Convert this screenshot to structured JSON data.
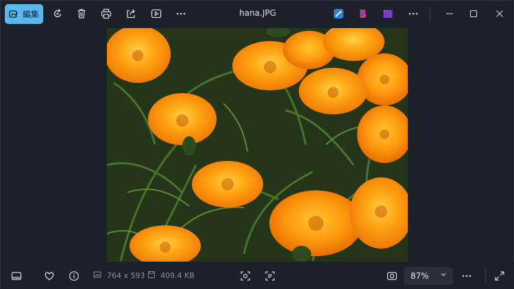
{
  "window": {
    "title": "hana.JPG"
  },
  "toolbar": {
    "edit_label": "編集",
    "items": [
      {
        "name": "rotate",
        "icon": "rotate-icon"
      },
      {
        "name": "delete",
        "icon": "trash-icon"
      },
      {
        "name": "print",
        "icon": "print-icon"
      },
      {
        "name": "share",
        "icon": "share-icon"
      },
      {
        "name": "slideshow",
        "icon": "play-icon"
      },
      {
        "name": "more",
        "icon": "more-icon"
      }
    ],
    "apps": [
      {
        "name": "designer",
        "icon": "designer-app-icon",
        "color": "#3a8ee6"
      },
      {
        "name": "clipchamp-b",
        "icon": "b-app-icon",
        "color": "#d23c8a"
      },
      {
        "name": "clipchamp",
        "icon": "clapper-app-icon",
        "color": "#7b3cc9"
      }
    ]
  },
  "bottom": {
    "dimensions": "764 x 593",
    "filesize": "409.4 KB",
    "zoom": "87%"
  },
  "colors": {
    "accent": "#5ab7f0",
    "background": "#1c2029"
  }
}
